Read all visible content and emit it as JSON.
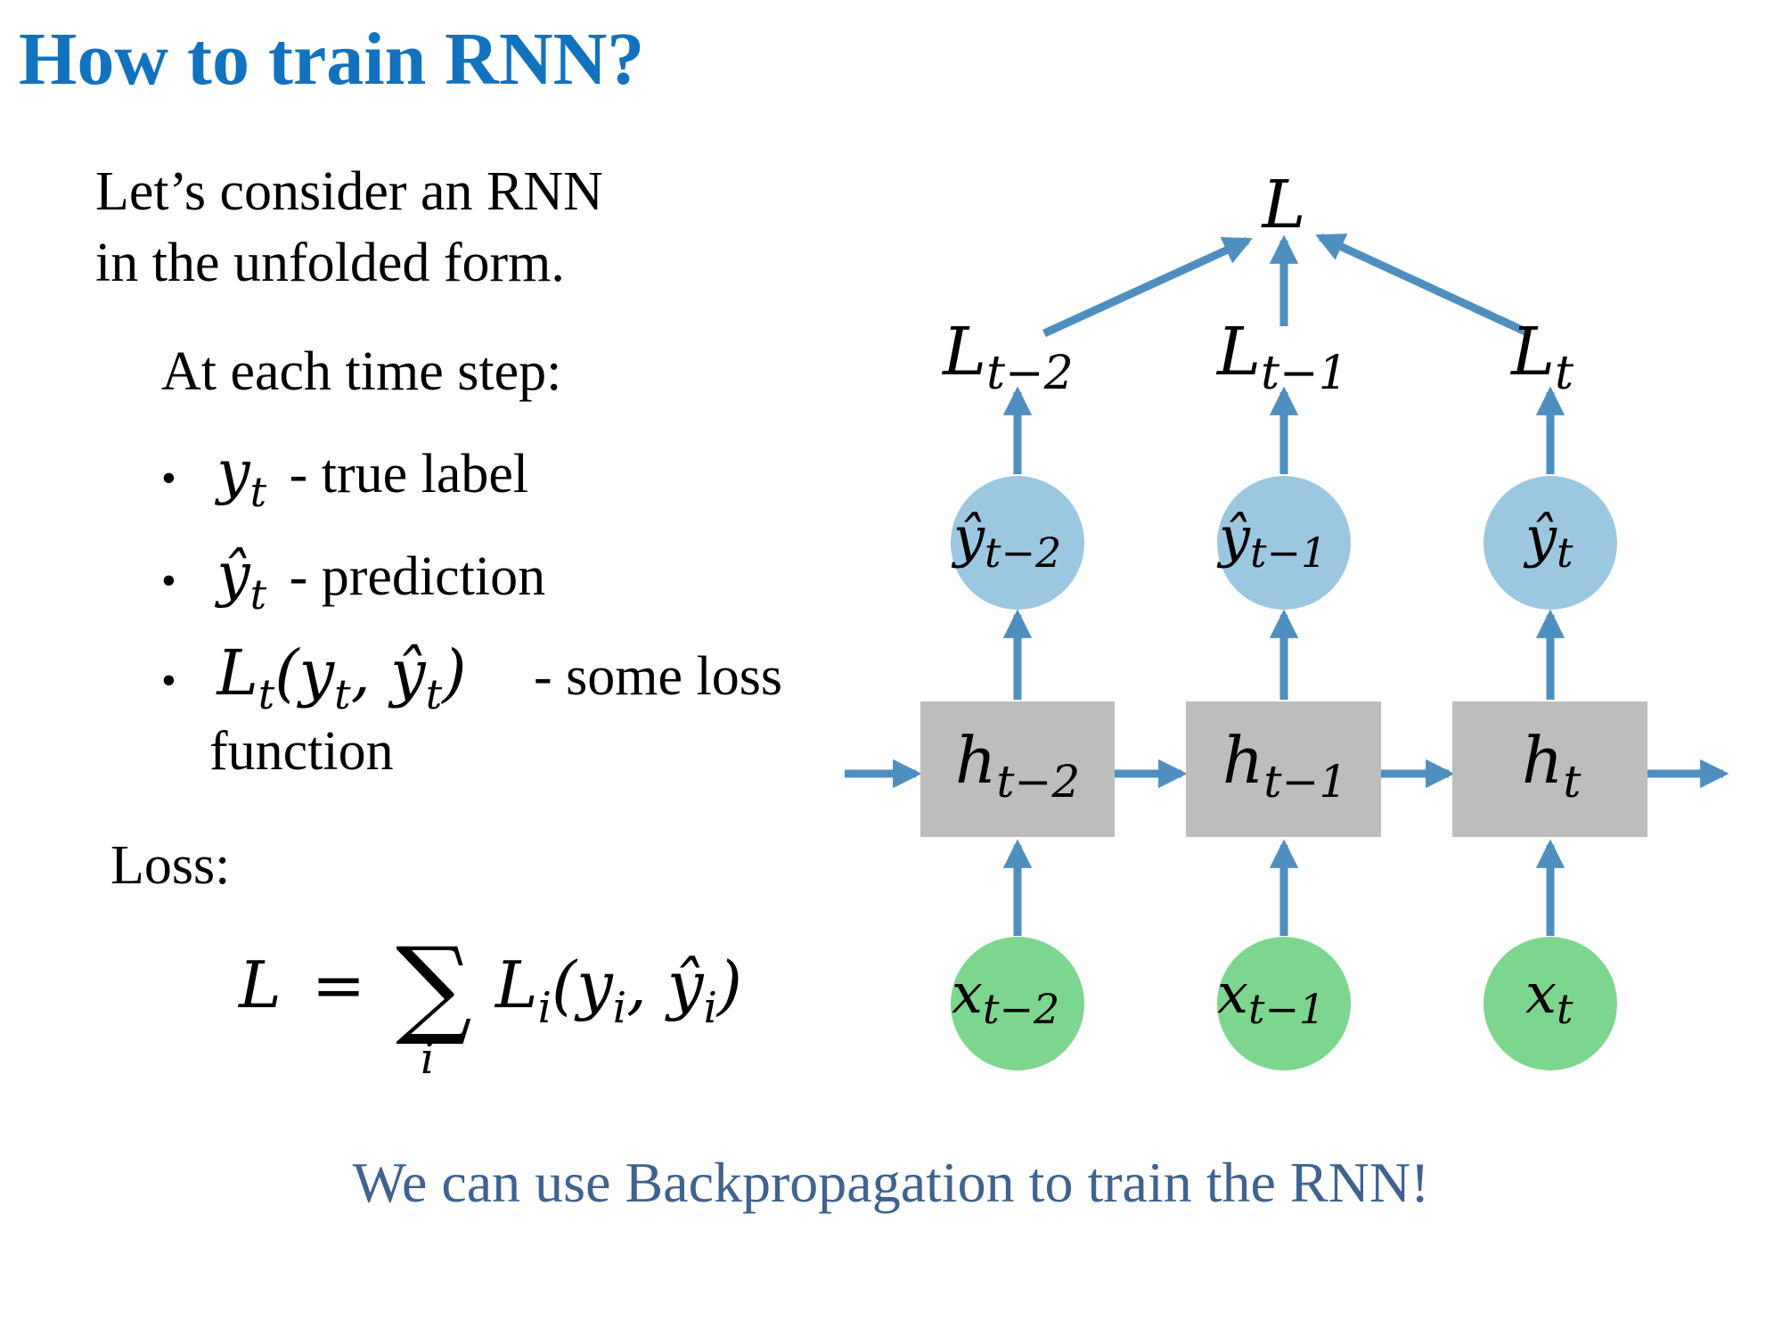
{
  "title": "How to train RNN?",
  "intro": {
    "line1": "Let’s consider an RNN",
    "line2": "in the unfolded form."
  },
  "time_step_heading": "At each time step:",
  "bullets": [
    {
      "math": "y",
      "sub": "t",
      "text": "- true label"
    },
    {
      "math": "ŷ",
      "sub": "t",
      "text": "- prediction"
    },
    {
      "math": "L",
      "sub": "t",
      "args": "(y",
      "args_sub": "t",
      "args2": ", ŷ",
      "args2_sub": "t",
      "args_close": ")",
      "text": "- some loss",
      "text2": "function"
    }
  ],
  "loss_label": "Loss:",
  "loss_formula": {
    "lhs": "L",
    "eq": "=",
    "sum": "∑",
    "sum_index": "i",
    "term": "L",
    "term_sub": "i",
    "args_open": "(y",
    "args_sub1": "i",
    "args_mid": ", ŷ",
    "args_sub2": "i",
    "args_close": ")"
  },
  "footer": "We can use Backpropagation to train the RNN!",
  "diagram": {
    "total_loss": "L",
    "columns": [
      {
        "loss": "L",
        "loss_sub": "t−2",
        "pred": "ŷ",
        "pred_sub": "t−2",
        "hidden": "h",
        "hidden_sub": "t−2",
        "input": "x",
        "input_sub": "t−2"
      },
      {
        "loss": "L",
        "loss_sub": "t−1",
        "pred": "ŷ",
        "pred_sub": "t−1",
        "hidden": "h",
        "hidden_sub": "t−1",
        "input": "x",
        "input_sub": "t−1"
      },
      {
        "loss": "L",
        "loss_sub": "t",
        "pred": "ŷ",
        "pred_sub": "t",
        "hidden": "h",
        "hidden_sub": "t",
        "input": "x",
        "input_sub": "t"
      }
    ],
    "colors": {
      "arrow": "#4f8fbf",
      "prediction_node": "#9cc7e0",
      "hidden_box": "#bdbdbd",
      "input_node": "#7dd68e",
      "title": "#1172bf",
      "footer": "#40628f"
    }
  }
}
